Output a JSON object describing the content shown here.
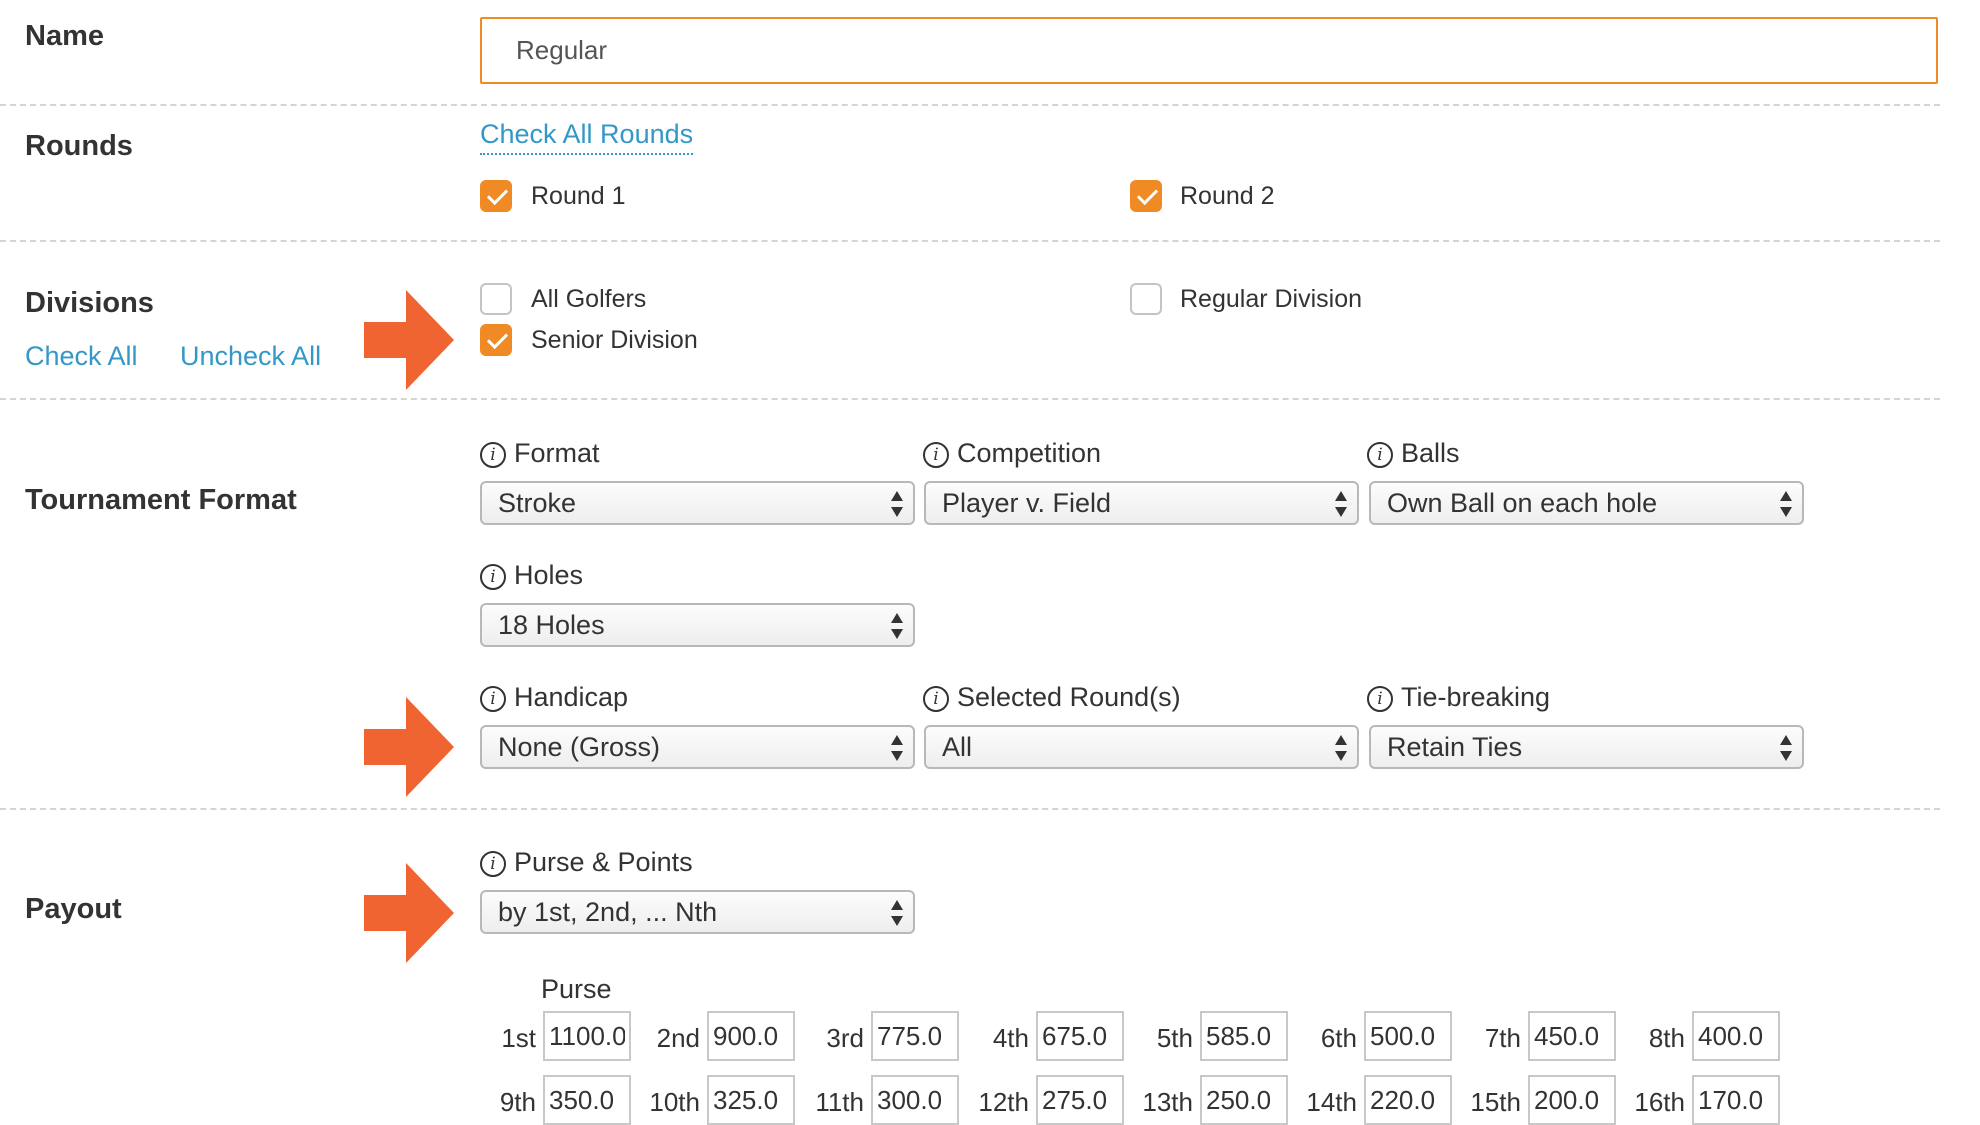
{
  "name": {
    "label": "Name",
    "value": "Regular"
  },
  "rounds": {
    "label": "Rounds",
    "check_all": "Check All Rounds",
    "items": [
      {
        "label": "Round 1",
        "checked": true
      },
      {
        "label": "Round 2",
        "checked": true
      }
    ]
  },
  "divisions": {
    "label": "Divisions",
    "check_all": "Check All",
    "uncheck_all": "Uncheck All",
    "items": [
      {
        "label": "All Golfers",
        "checked": false
      },
      {
        "label": "Regular Division",
        "checked": false
      },
      {
        "label": "Senior Division",
        "checked": true
      }
    ]
  },
  "format": {
    "label": "Tournament Format",
    "fields": {
      "format": {
        "label": "Format",
        "value": "Stroke"
      },
      "competition": {
        "label": "Competition",
        "value": "Player v. Field"
      },
      "balls": {
        "label": "Balls",
        "value": "Own Ball on each hole"
      },
      "holes": {
        "label": "Holes",
        "value": "18 Holes"
      },
      "handicap": {
        "label": "Handicap",
        "value": "None (Gross)"
      },
      "selected_rounds": {
        "label": "Selected Round(s)",
        "value": "All"
      },
      "tie_breaking": {
        "label": "Tie-breaking",
        "value": "Retain Ties"
      }
    }
  },
  "payout": {
    "label": "Payout",
    "purse_points": {
      "label": "Purse & Points",
      "value": "by 1st, 2nd, ... Nth"
    },
    "purse_header": "Purse",
    "places": [
      {
        "place": "1st",
        "value": "1100.0"
      },
      {
        "place": "2nd",
        "value": "900.0"
      },
      {
        "place": "3rd",
        "value": "775.0"
      },
      {
        "place": "4th",
        "value": "675.0"
      },
      {
        "place": "5th",
        "value": "585.0"
      },
      {
        "place": "6th",
        "value": "500.0"
      },
      {
        "place": "7th",
        "value": "450.0"
      },
      {
        "place": "8th",
        "value": "400.0"
      },
      {
        "place": "9th",
        "value": "350.0"
      },
      {
        "place": "10th",
        "value": "325.0"
      },
      {
        "place": "11th",
        "value": "300.0"
      },
      {
        "place": "12th",
        "value": "275.0"
      },
      {
        "place": "13th",
        "value": "250.0"
      },
      {
        "place": "14th",
        "value": "220.0"
      },
      {
        "place": "15th",
        "value": "200.0"
      },
      {
        "place": "16th",
        "value": "170.0"
      }
    ]
  },
  "colors": {
    "accent": "#f08a24",
    "link": "#3498c7",
    "arrow": "#ef6430"
  }
}
